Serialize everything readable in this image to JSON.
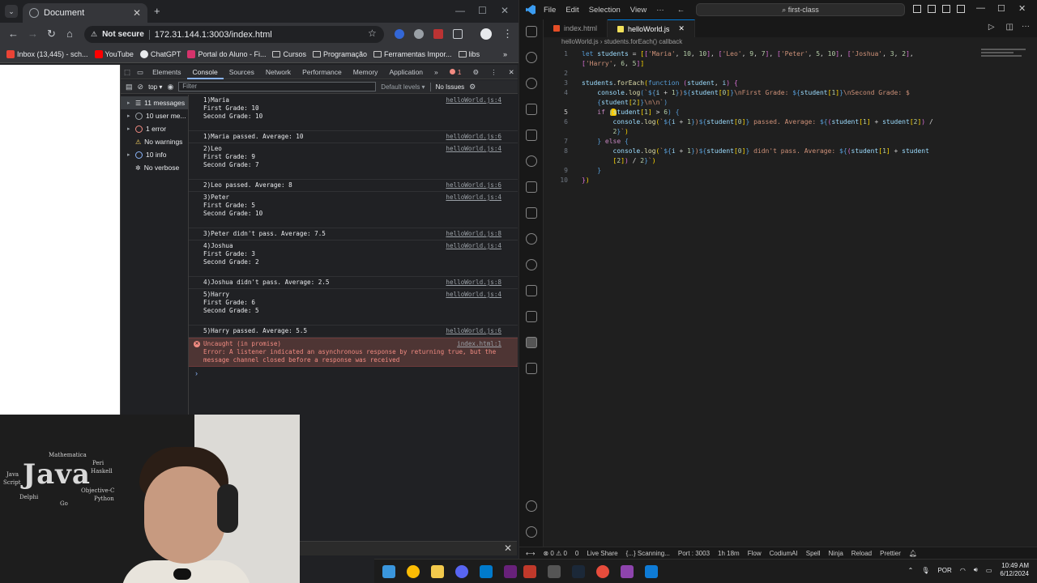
{
  "browser": {
    "tab_title": "Document",
    "security": "Not secure",
    "url": "172.31.144.1:3003/index.html",
    "bookmarks": [
      "Inbox (13,445) - sch...",
      "YouTube",
      "ChatGPT",
      "Portal do Aluno - Fi...",
      "Cursos",
      "Programação",
      "Ferramentas Impor...",
      "libs"
    ]
  },
  "devtools": {
    "tabs": [
      "Elements",
      "Console",
      "Sources",
      "Network",
      "Performance",
      "Memory",
      "Application"
    ],
    "active_tab": "Console",
    "context": "top",
    "filter_placeholder": "Filter",
    "levels": "Default levels",
    "issues": "No Issues",
    "error_count": "1",
    "sidebar": [
      {
        "label": "11 messages",
        "arrow": "▸"
      },
      {
        "label": "10 user me...",
        "arrow": "▸"
      },
      {
        "label": "1 error",
        "arrow": "▸"
      },
      {
        "label": "No warnings",
        "arrow": ""
      },
      {
        "label": "10 info",
        "arrow": "▸"
      },
      {
        "label": "No verbose",
        "arrow": ""
      }
    ],
    "logs": [
      {
        "text": "1)Maria\nFirst Grade: 10\nSecond Grade: 10\n ",
        "src": "helloWorld.js:4"
      },
      {
        "text": "1)Maria passed. Average: 10",
        "src": "helloWorld.js:6"
      },
      {
        "text": "2)Leo\nFirst Grade: 9\nSecond Grade: 7\n ",
        "src": "helloWorld.js:4"
      },
      {
        "text": "2)Leo passed. Average: 8",
        "src": "helloWorld.js:6"
      },
      {
        "text": "3)Peter\nFirst Grade: 5\nSecond Grade: 10\n ",
        "src": "helloWorld.js:4"
      },
      {
        "text": "3)Peter didn't pass. Average: 7.5",
        "src": "helloWorld.js:8"
      },
      {
        "text": "4)Joshua\nFirst Grade: 3\nSecond Grade: 2\n ",
        "src": "helloWorld.js:4"
      },
      {
        "text": "4)Joshua didn't pass. Average: 2.5",
        "src": "helloWorld.js:8"
      },
      {
        "text": "5)Harry\nFirst Grade: 6\nSecond Grade: 5\n ",
        "src": "helloWorld.js:4"
      },
      {
        "text": "5)Harry passed. Average: 5.5",
        "src": "helloWorld.js:6"
      }
    ],
    "error": {
      "text": "Uncaught (in promise)\nError: A listener indicated an asynchronous response by returning true, but the\nmessage channel closed before a response was received",
      "src": "index.html:1"
    },
    "prompt": "›"
  },
  "webcam": {
    "big_word": "Java",
    "words": [
      "Script",
      "Java",
      "Peri",
      "Haskell",
      "Python",
      "Objective-C",
      "Mathematica",
      "Delphi",
      "Go"
    ]
  },
  "vscode": {
    "menus": [
      "File",
      "Edit",
      "Selection",
      "View",
      "···"
    ],
    "search": "first-class",
    "tabs": [
      {
        "label": "index.html",
        "active": false
      },
      {
        "label": "helloWorld.js",
        "active": true
      }
    ],
    "breadcrumb": "helloWorld.js  ›  students.forEach() callback",
    "line_numbers": [
      "1",
      "2",
      "3",
      "4",
      "5",
      "6",
      "7",
      "8",
      "9",
      "10"
    ],
    "status": [
      "⊗ 0 ⚠ 0",
      "0",
      "Live Share",
      "{...} Scanning...",
      "Port : 3003",
      "1h 18m",
      "Flow",
      "CodiumAI",
      "Spell",
      "Ninja",
      "Reload",
      "Prettier"
    ]
  },
  "taskbar": {
    "lang": "POR",
    "time": "10:49 AM",
    "date": "6/12/2024"
  },
  "colors": {
    "accent": "#0078d4",
    "error_bg": "#4e3534",
    "error_text": "#f28b82"
  }
}
